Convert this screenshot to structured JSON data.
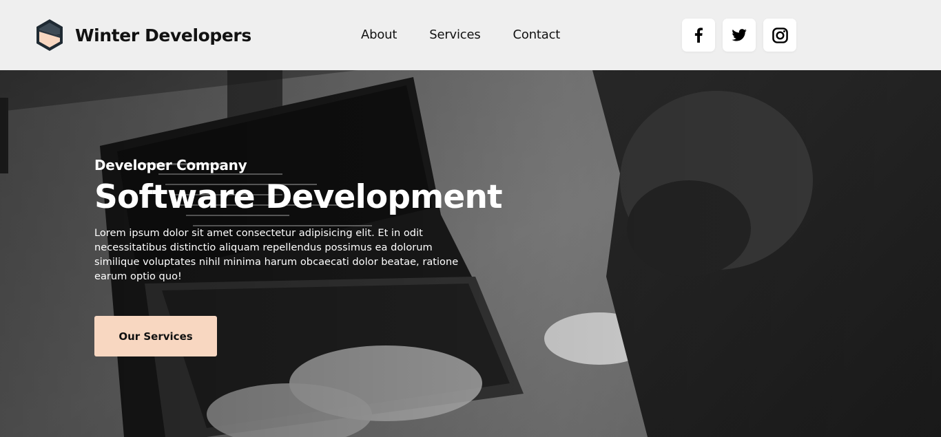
{
  "brand": {
    "name": "Winter Developers",
    "logo_icon": "hexagon-logo-icon"
  },
  "nav": {
    "items": [
      {
        "label": "About"
      },
      {
        "label": "Services"
      },
      {
        "label": "Contact"
      }
    ]
  },
  "socials": [
    {
      "icon": "facebook-icon"
    },
    {
      "icon": "twitter-icon"
    },
    {
      "icon": "instagram-icon"
    }
  ],
  "hero": {
    "eyebrow": "Developer Company",
    "title": "Software Development",
    "text": "Lorem ipsum dolor sit amet consectetur adipisicing elit. Et in odit necessitatibus distinctio aliquam repellendus possimus ea dolorum similique voluptates nihil minima harum obcaecati dolor beatae, ratione earum optio quo!",
    "cta_label": "Our Services",
    "photo": "grayscale-person-typing-on-laptop"
  },
  "colors": {
    "header_bg": "#efefef",
    "cta_bg": "#f8d7c1",
    "logo_accent": "#f8d7c1",
    "logo_dark": "#1f2a33"
  }
}
